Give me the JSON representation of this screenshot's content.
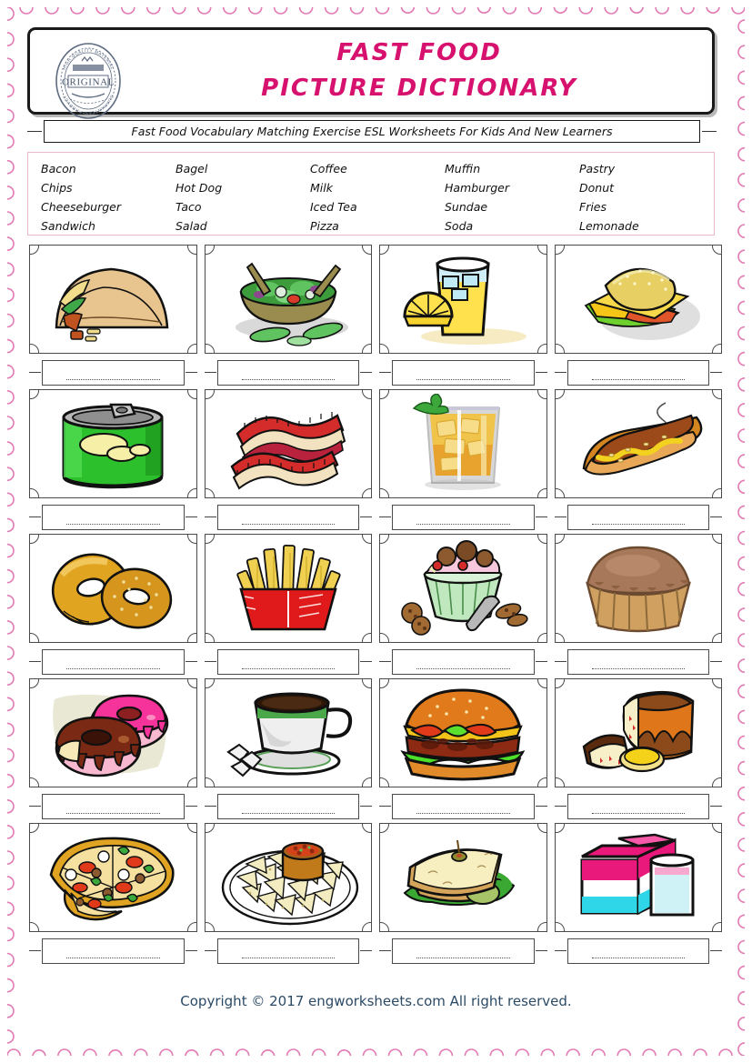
{
  "page": {
    "border_color": "#e27ab4",
    "title_color": "#d6126e",
    "footer_color": "#2b4a66"
  },
  "header": {
    "stamp_label": "ORIGINAL",
    "stamp_top_arc": "HIGH QUALITY MATERIAL",
    "stamp_bottom_arc": "GUARANTEED PRODUCT",
    "title_line1": "FAST FOOD",
    "title_line2": "PICTURE DICTIONARY",
    "subtitle": "Fast Food Vocabulary Matching Exercise ESL Worksheets For Kids And New Learners"
  },
  "word_bank": {
    "words": [
      "Bacon",
      "Bagel",
      "Coffee",
      "Muffin",
      "Pastry",
      "Chips",
      "Hot Dog",
      "Milk",
      "Hamburger",
      "Donut",
      "Cheeseburger",
      "Taco",
      "Iced Tea",
      "Sundae",
      "Fries",
      "Sandwich",
      "Salad",
      "Pizza",
      "Soda",
      "Lemonade"
    ]
  },
  "grid": {
    "answer_placeholder": "",
    "cells": [
      {
        "icon": "taco-icon",
        "answer": ""
      },
      {
        "icon": "salad-icon",
        "answer": ""
      },
      {
        "icon": "lemonade-icon",
        "answer": ""
      },
      {
        "icon": "cheeseburger-icon",
        "answer": ""
      },
      {
        "icon": "soda-can-icon",
        "answer": ""
      },
      {
        "icon": "bacon-icon",
        "answer": ""
      },
      {
        "icon": "iced-tea-icon",
        "answer": ""
      },
      {
        "icon": "hot-dog-icon",
        "answer": ""
      },
      {
        "icon": "bagel-icon",
        "answer": ""
      },
      {
        "icon": "fries-icon",
        "answer": ""
      },
      {
        "icon": "sundae-icon",
        "answer": ""
      },
      {
        "icon": "muffin-icon",
        "answer": ""
      },
      {
        "icon": "donut-icon",
        "answer": ""
      },
      {
        "icon": "coffee-icon",
        "answer": ""
      },
      {
        "icon": "hamburger-icon",
        "answer": ""
      },
      {
        "icon": "pastry-icon",
        "answer": ""
      },
      {
        "icon": "pizza-icon",
        "answer": ""
      },
      {
        "icon": "chips-icon",
        "answer": ""
      },
      {
        "icon": "sandwich-icon",
        "answer": ""
      },
      {
        "icon": "milk-icon",
        "answer": ""
      }
    ]
  },
  "footer": {
    "copyright": "Copyright © 2017 engworksheets.com All right reserved."
  }
}
